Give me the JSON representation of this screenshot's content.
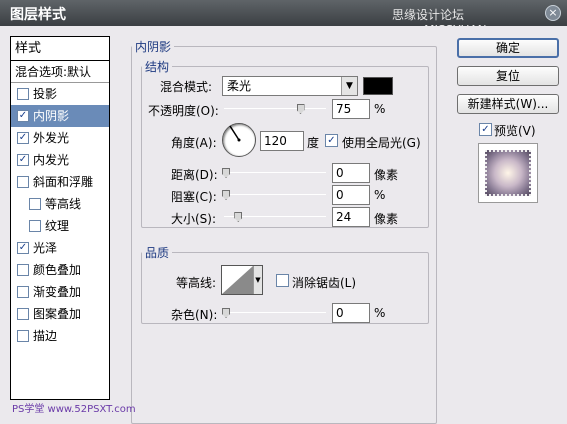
{
  "window": {
    "title": "图层样式",
    "watermark": "思缘设计论坛 www.MISSYUAN.com",
    "close_glyph": "×"
  },
  "style_list": {
    "header": "样式",
    "blend_options": "混合选项:默认",
    "items": [
      {
        "label": "投影",
        "checked": false,
        "sub": false,
        "selected": false
      },
      {
        "label": "内阴影",
        "checked": true,
        "sub": false,
        "selected": true
      },
      {
        "label": "外发光",
        "checked": true,
        "sub": false,
        "selected": false
      },
      {
        "label": "内发光",
        "checked": true,
        "sub": false,
        "selected": false
      },
      {
        "label": "斜面和浮雕",
        "checked": false,
        "sub": false,
        "selected": false
      },
      {
        "label": "等高线",
        "checked": false,
        "sub": true,
        "selected": false
      },
      {
        "label": "纹理",
        "checked": false,
        "sub": true,
        "selected": false
      },
      {
        "label": "光泽",
        "checked": true,
        "sub": false,
        "selected": false
      },
      {
        "label": "颜色叠加",
        "checked": false,
        "sub": false,
        "selected": false
      },
      {
        "label": "渐变叠加",
        "checked": false,
        "sub": false,
        "selected": false
      },
      {
        "label": "图案叠加",
        "checked": false,
        "sub": false,
        "selected": false
      },
      {
        "label": "描边",
        "checked": false,
        "sub": false,
        "selected": false
      }
    ]
  },
  "panel": {
    "title": "内阴影",
    "structure": {
      "title": "结构",
      "blend_mode_label": "混合模式:",
      "blend_mode_value": "柔光",
      "color": "#000000",
      "opacity_label": "不透明度(O):",
      "opacity_value": "75",
      "opacity_unit": "%",
      "angle_label": "角度(A):",
      "angle_value": "120",
      "angle_unit": "度",
      "global_light_label": "使用全局光(G)",
      "global_light_checked": true,
      "distance_label": "距离(D):",
      "distance_value": "0",
      "distance_unit": "像素",
      "choke_label": "阻塞(C):",
      "choke_value": "0",
      "choke_unit": "%",
      "size_label": "大小(S):",
      "size_value": "24",
      "size_unit": "像素"
    },
    "quality": {
      "title": "品质",
      "contour_label": "等高线:",
      "antialias_label": "消除锯齿(L)",
      "antialias_checked": false,
      "noise_label": "杂色(N):",
      "noise_value": "0",
      "noise_unit": "%"
    }
  },
  "buttons": {
    "ok": "确定",
    "reset": "复位",
    "new_style": "新建样式(W)...",
    "preview_label": "预览(V)",
    "preview_checked": true
  },
  "footer_watermark": "PS学堂 www.52PSXT.com",
  "check_glyph": "✓",
  "dropdown_glyph": "▼"
}
